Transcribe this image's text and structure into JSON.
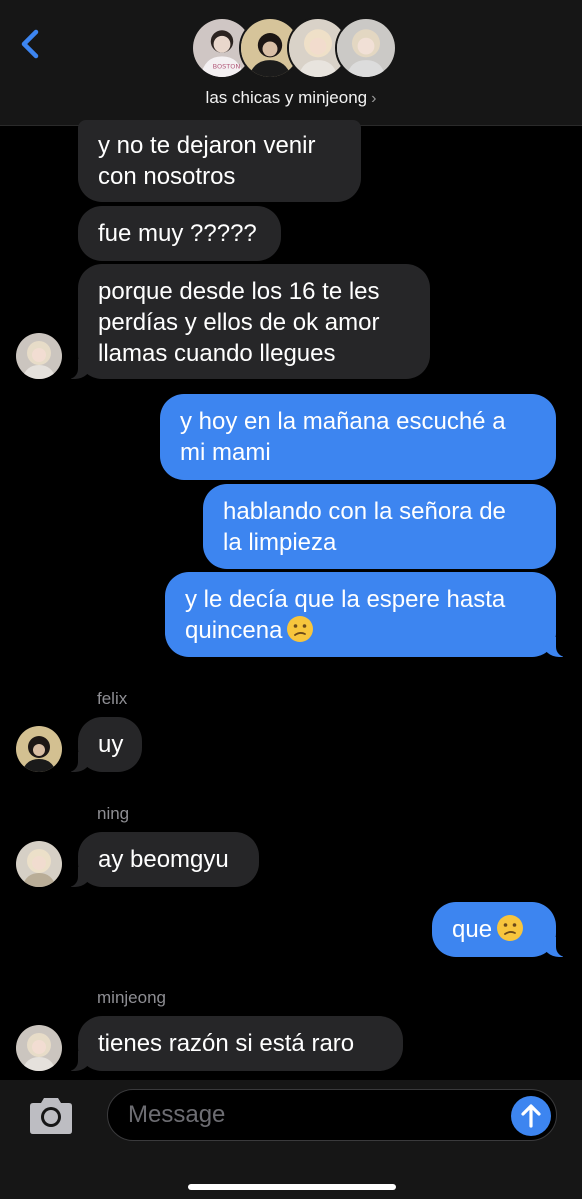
{
  "header": {
    "group_name": "las chicas y minjeong",
    "chevron": "›",
    "back_icon": "chevron-left-icon"
  },
  "colors": {
    "accent": "#3d85f0",
    "incoming_bubble": "#262628",
    "header_bg": "#161616"
  },
  "messages": [
    {
      "text_lines": [
        "y no te dejaron venir",
        "con nosotros"
      ]
    },
    {
      "text": "fue muy ?????"
    },
    {
      "text_lines": [
        "porque desde los 16 te les",
        "perdías y ellos de ok amor",
        "llamas cuando llegues"
      ]
    },
    {
      "text_lines": [
        "y hoy en la mañana escuché a",
        "mi mami"
      ]
    },
    {
      "text_lines": [
        "hablando con la señora de",
        "la limpieza"
      ]
    },
    {
      "text_lines": [
        "y le decía que la espere hasta",
        "quincena"
      ]
    },
    {
      "sender": "felix",
      "text": "uy"
    },
    {
      "sender": "ning",
      "text": "ay beomgyu"
    },
    {
      "text": "que"
    },
    {
      "sender": "minjeong",
      "text": "tienes razón si está raro"
    }
  ],
  "composer": {
    "placeholder": "Message",
    "camera_icon": "camera-icon",
    "send_icon": "arrow-up-icon"
  }
}
